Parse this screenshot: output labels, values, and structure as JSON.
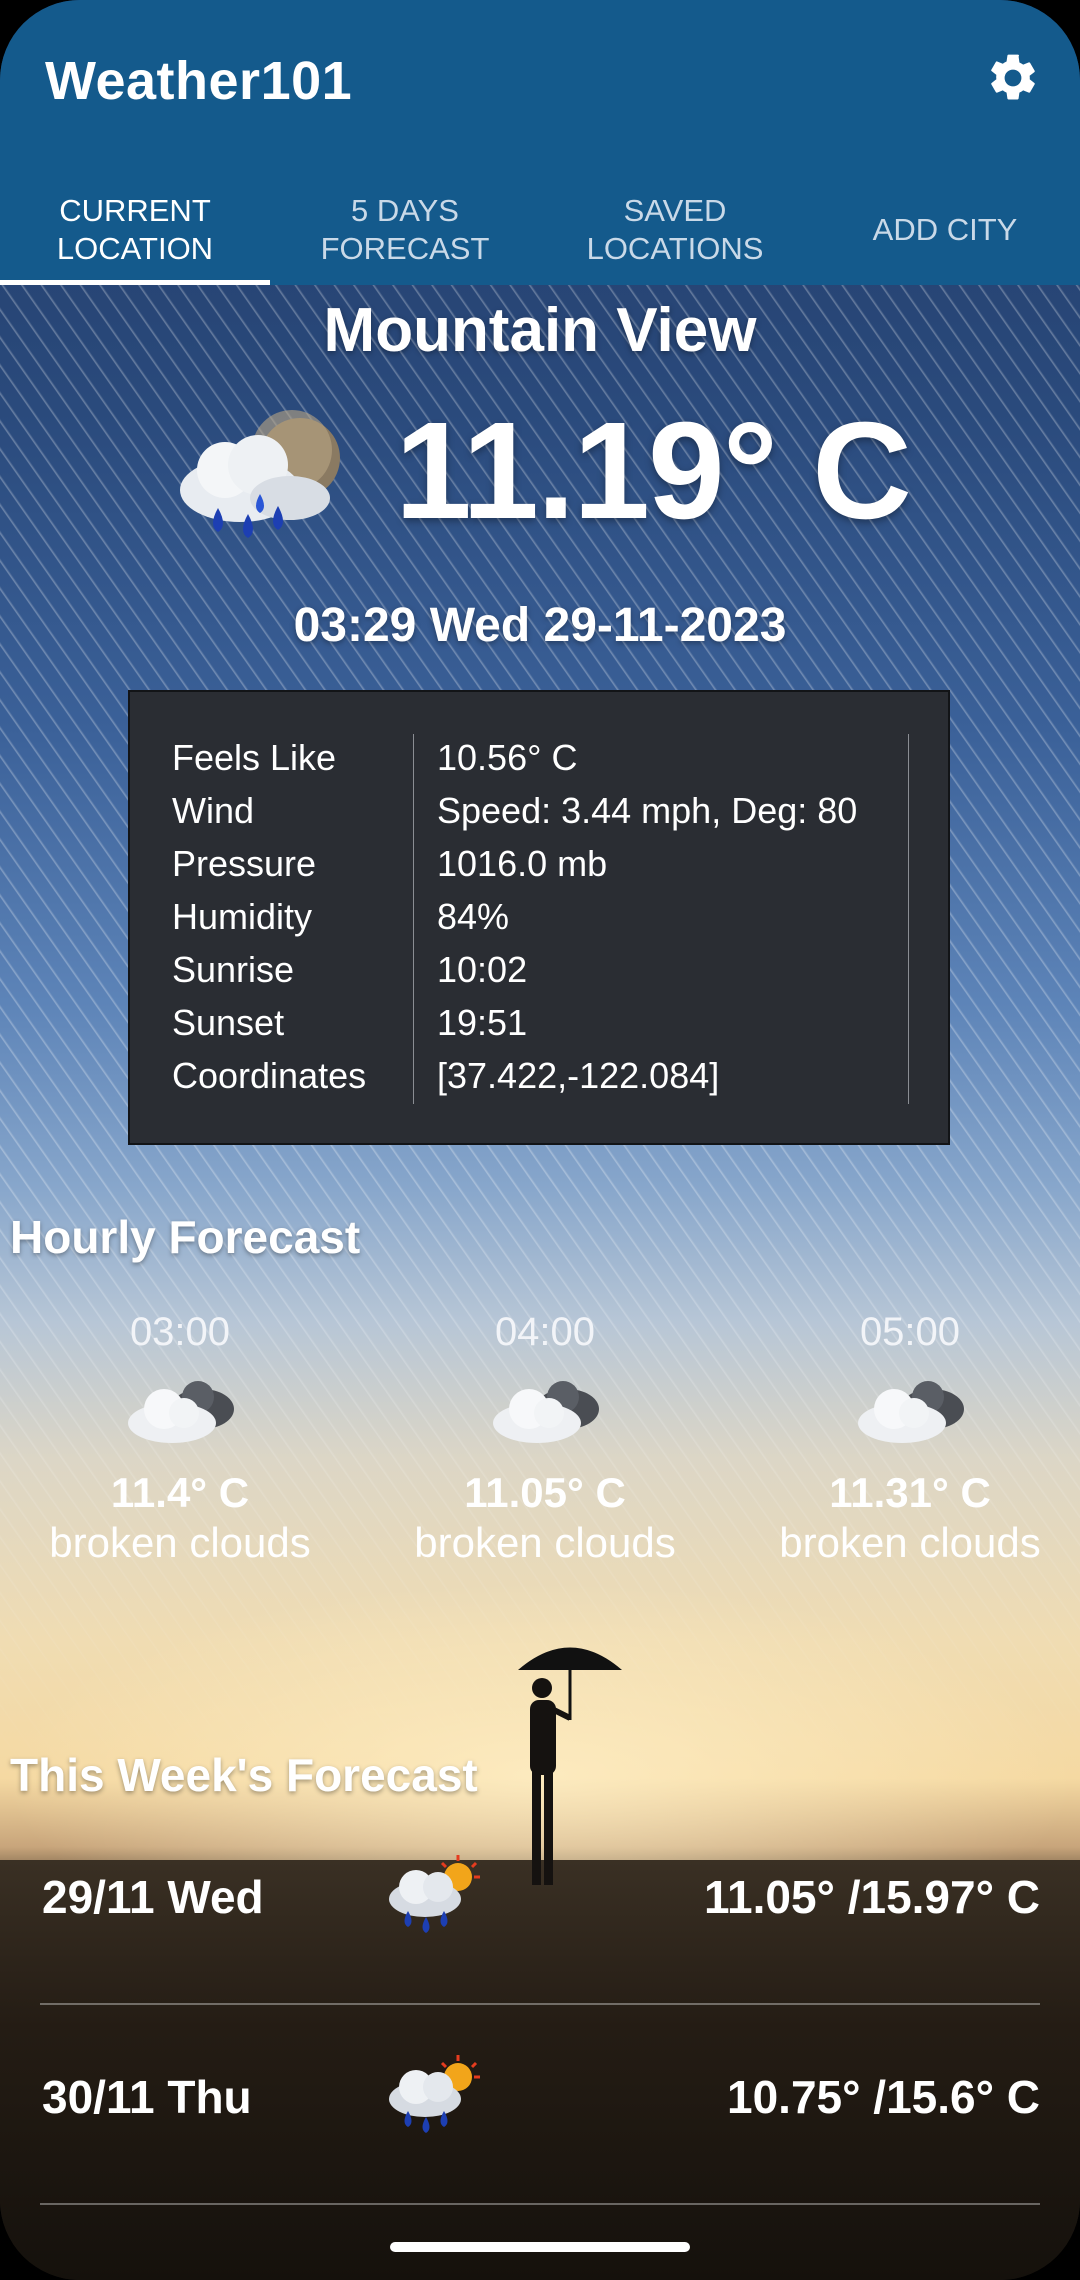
{
  "app": {
    "title": "Weather101",
    "settings_icon": "gear-icon"
  },
  "tabs": [
    {
      "label": "CURRENT\nLOCATION",
      "active": true
    },
    {
      "label": "5 DAYS\nFORECAST",
      "active": false
    },
    {
      "label": "SAVED\nLOCATIONS",
      "active": false
    },
    {
      "label": "ADD CITY",
      "active": false
    }
  ],
  "current": {
    "city": "Mountain View",
    "temperature": "11.19° C",
    "icon": "rain-clouds-moon-icon",
    "datetime": "03:29 Wed 29-11-2023"
  },
  "details": [
    {
      "label": "Feels Like",
      "value": "10.56° C"
    },
    {
      "label": "Wind",
      "value": "Speed: 3.44 mph, Deg: 80"
    },
    {
      "label": "Pressure",
      "value": "1016.0 mb"
    },
    {
      "label": "Humidity",
      "value": "84%"
    },
    {
      "label": "Sunrise",
      "value": "10:02"
    },
    {
      "label": "Sunset",
      "value": "19:51"
    },
    {
      "label": "Coordinates",
      "value": "[37.422,-122.084]"
    }
  ],
  "hourly": {
    "title": "Hourly Forecast",
    "items": [
      {
        "time": "03:00",
        "icon": "broken-clouds-icon",
        "temp": "11.4° C",
        "desc": "broken clouds"
      },
      {
        "time": "04:00",
        "icon": "broken-clouds-icon",
        "temp": "11.05° C",
        "desc": "broken clouds"
      },
      {
        "time": "05:00",
        "icon": "broken-clouds-icon",
        "temp": "11.31° C",
        "desc": "broken clouds"
      }
    ]
  },
  "weekly": {
    "title": "This Week's Forecast",
    "items": [
      {
        "day": "29/11 Wed",
        "icon": "rain-clouds-sun-icon",
        "temps": "11.05° /15.97° C"
      },
      {
        "day": "30/11 Thu",
        "icon": "rain-clouds-sun-icon",
        "temps": "10.75° /15.6° C"
      }
    ]
  }
}
